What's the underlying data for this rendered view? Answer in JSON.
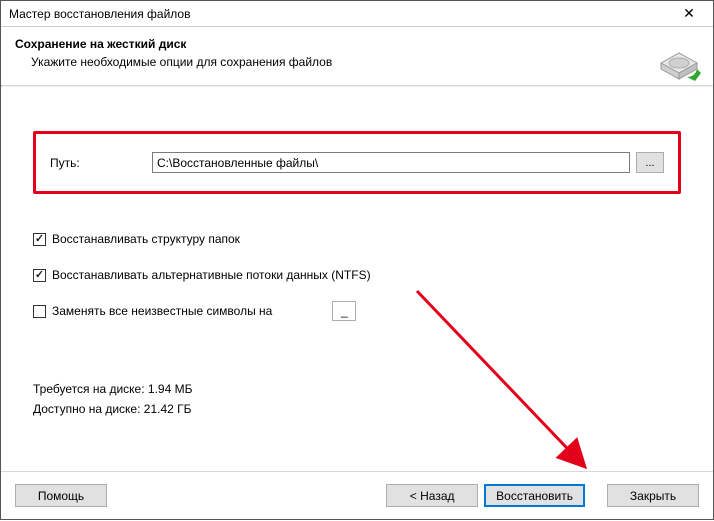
{
  "window": {
    "title": "Мастер восстановления файлов"
  },
  "header": {
    "title": "Сохранение на жесткий диск",
    "subtitle": "Укажите необходимые опции для сохранения файлов"
  },
  "path": {
    "label": "Путь:",
    "value": "C:\\Восстановленные файлы\\",
    "browse": "..."
  },
  "options": {
    "restore_structure": {
      "label": "Восстанавливать структуру папок",
      "checked": true
    },
    "restore_ads": {
      "label": "Восстанавливать альтернативные потоки данных (NTFS)",
      "checked": true
    },
    "replace_unknown": {
      "label": "Заменять все неизвестные символы на",
      "checked": false,
      "value": "_"
    }
  },
  "stats": {
    "required_label": "Требуется на диске:",
    "required_value": "1.94 МБ",
    "available_label": "Доступно на диске:",
    "available_value": "21.42 ГБ"
  },
  "buttons": {
    "help": "Помощь",
    "back": "< Назад",
    "recover": "Восстановить",
    "close": "Закрыть"
  }
}
